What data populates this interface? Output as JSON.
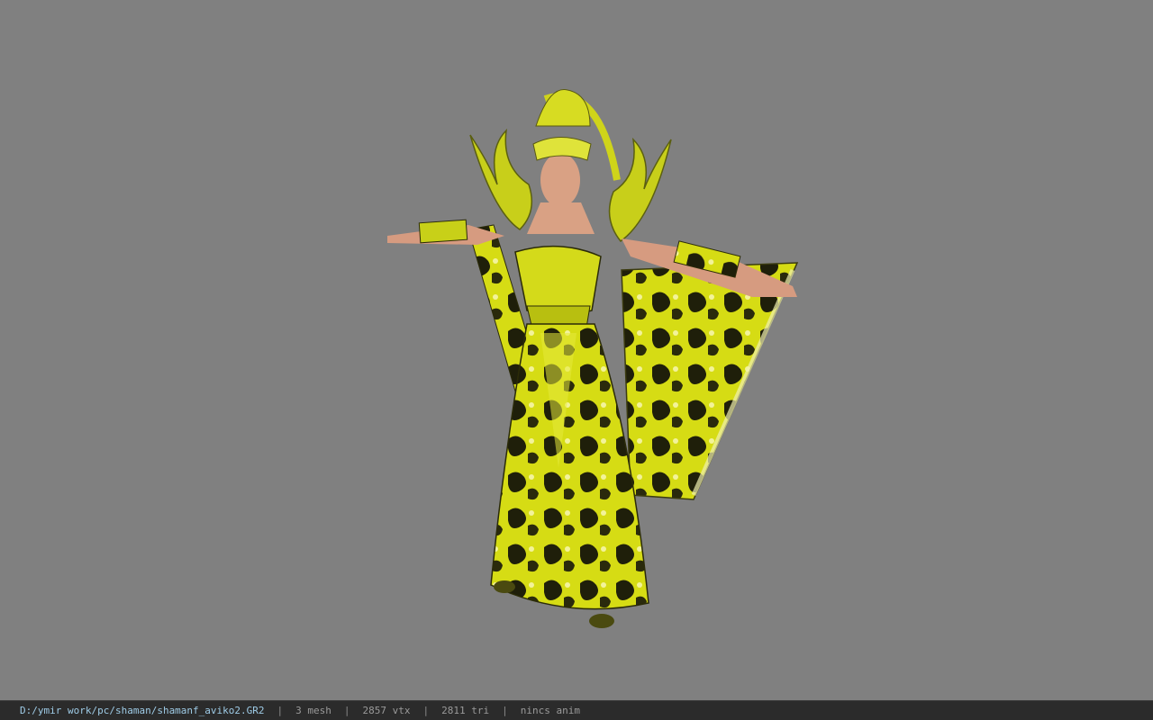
{
  "viewer": {
    "background_color": "#808080",
    "model_primary_color": "#d8e01a",
    "model_dark_color": "#1a1a08"
  },
  "status_bar": {
    "file_path": "D:/ymir work/pc/shaman/shamanf_aviko2.GR2",
    "mesh_count": "3 mesh",
    "vertex_count": "2857 vtx",
    "triangle_count": "2811 tri",
    "animation": "nincs anim"
  }
}
